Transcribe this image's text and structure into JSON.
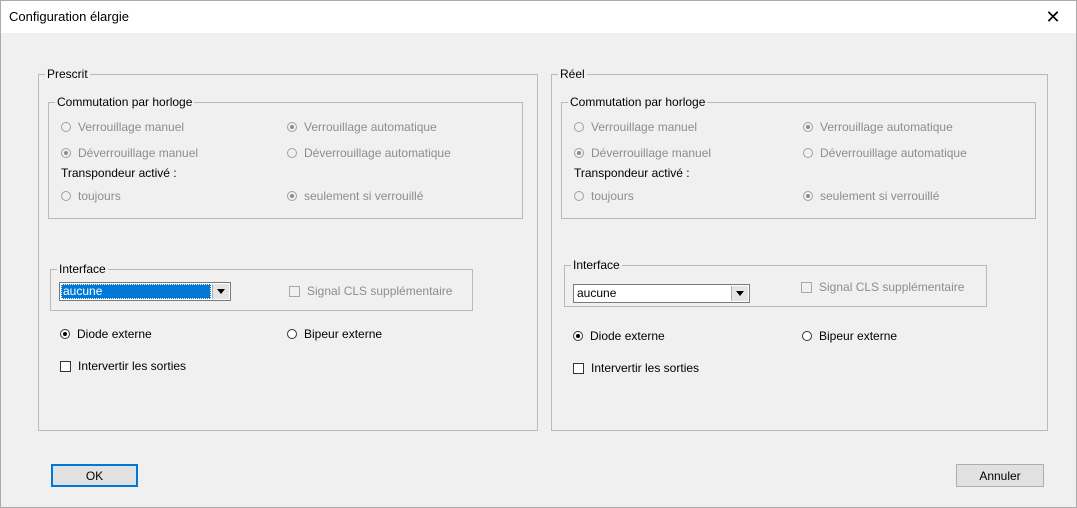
{
  "window": {
    "title": "Configuration élargie",
    "close_glyph": "✕"
  },
  "panels": {
    "prescrit": {
      "title": "Prescrit",
      "clock": {
        "title": "Commutation par horloge",
        "manual_lock": "Verrouillage manuel",
        "auto_lock": "Verrouillage automatique",
        "manual_unlock": "Déverrouillage manuel",
        "auto_unlock": "Déverrouillage automatique",
        "transponder_label": "Transpondeur activé :",
        "always": "toujours",
        "only_if_locked": "seulement si verrouillé"
      },
      "interface": {
        "title": "Interface",
        "selected": "aucune",
        "cls_signal": "Signal CLS supplémentaire"
      },
      "diode": "Diode externe",
      "beeper": "Bipeur externe",
      "swap_outputs": "Intervertir les sorties"
    },
    "reel": {
      "title": "Réel",
      "clock": {
        "title": "Commutation par horloge",
        "manual_lock": "Verrouillage manuel",
        "auto_lock": "Verrouillage automatique",
        "manual_unlock": "Déverrouillage manuel",
        "auto_unlock": "Déverrouillage automatique",
        "transponder_label": "Transpondeur activé :",
        "always": "toujours",
        "only_if_locked": "seulement si verrouillé"
      },
      "interface": {
        "title": "Interface",
        "selected": "aucune",
        "cls_signal": "Signal CLS supplémentaire"
      },
      "diode": "Diode externe",
      "beeper": "Bipeur externe",
      "swap_outputs": "Intervertir les sorties"
    }
  },
  "buttons": {
    "ok": "OK",
    "cancel": "Annuler"
  }
}
